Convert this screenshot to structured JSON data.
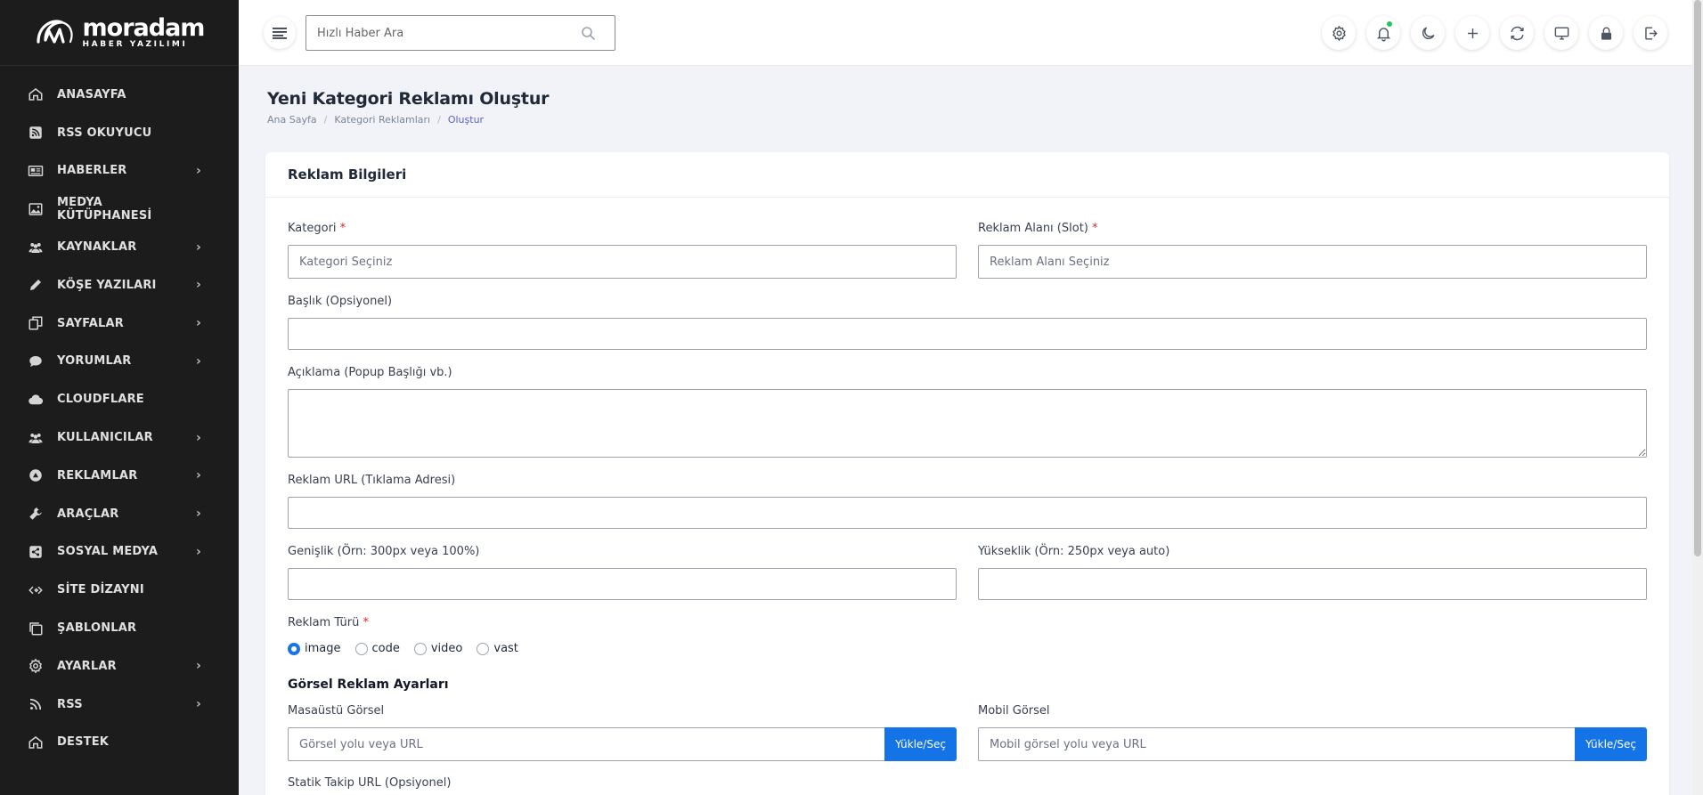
{
  "brand": {
    "name": "moradam",
    "subtitle": "HABER YAZILIMI"
  },
  "sidebar": {
    "items": [
      {
        "label": "ANASAYFA",
        "icon": "home-icon",
        "has_children": false
      },
      {
        "label": "RSS OKUYUCU",
        "icon": "rss-square-icon",
        "has_children": false
      },
      {
        "label": "HABERLER",
        "icon": "newspaper-icon",
        "has_children": true
      },
      {
        "label": "MEDYA KÜTÜPHANESİ",
        "icon": "image-icon",
        "has_children": false
      },
      {
        "label": "KAYNAKLAR",
        "icon": "users-icon",
        "has_children": true
      },
      {
        "label": "KÖŞE YAZILARI",
        "icon": "pencil-icon",
        "has_children": true
      },
      {
        "label": "SAYFALAR",
        "icon": "pages-icon",
        "has_children": true
      },
      {
        "label": "YORUMLAR",
        "icon": "comment-icon",
        "has_children": true
      },
      {
        "label": "CLOUDFLARE",
        "icon": "cloud-icon",
        "has_children": false
      },
      {
        "label": "KULLANICILAR",
        "icon": "users-icon",
        "has_children": true
      },
      {
        "label": "REKLAMLAR",
        "icon": "ad-icon",
        "has_children": true
      },
      {
        "label": "ARAÇLAR",
        "icon": "wrench-icon",
        "has_children": true
      },
      {
        "label": "SOSYAL MEDYA",
        "icon": "share-icon",
        "has_children": true
      },
      {
        "label": "SİTE DİZAYNI",
        "icon": "code-icon",
        "has_children": false
      },
      {
        "label": "ŞABLONLAR",
        "icon": "copy-icon",
        "has_children": false
      },
      {
        "label": "AYARLAR",
        "icon": "gear-icon",
        "has_children": true
      },
      {
        "label": "RSS",
        "icon": "rss-icon",
        "has_children": true
      },
      {
        "label": "DESTEK",
        "icon": "home-icon",
        "has_children": false
      }
    ],
    "chevron": "›"
  },
  "topbar": {
    "search_placeholder": "Hızlı Haber Ara",
    "icons": [
      "gear-icon",
      "bell-icon",
      "moon-icon",
      "plus-icon",
      "refresh-icon",
      "monitor-icon",
      "lock-icon",
      "logout-icon"
    ],
    "notification_dot_color": "#22c55e"
  },
  "page": {
    "title": "Yeni Kategori Reklamı Oluştur",
    "breadcrumb": [
      "Ana Sayfa",
      "Kategori Reklamları",
      "Oluştur"
    ],
    "breadcrumb_sep": "/"
  },
  "form": {
    "card_title": "Reklam Bilgileri",
    "required_mark": "*",
    "kategori": {
      "label": "Kategori",
      "placeholder": "Kategori Seçiniz"
    },
    "slot": {
      "label": "Reklam Alanı (Slot)",
      "placeholder": "Reklam Alanı Seçiniz"
    },
    "baslik": {
      "label": "Başlık (Opsiyonel)",
      "value": ""
    },
    "aciklama": {
      "label": "Açıklama (Popup Başlığı vb.)",
      "value": ""
    },
    "url": {
      "label": "Reklam URL (Tıklama Adresi)",
      "value": ""
    },
    "genislik": {
      "label": "Genişlik (Örn: 300px veya 100%)",
      "value": ""
    },
    "yukseklik": {
      "label": "Yükseklik (Örn: 250px veya auto)",
      "value": ""
    },
    "tur": {
      "label": "Reklam Türü",
      "options": [
        "image",
        "code",
        "video",
        "vast"
      ],
      "selected": "image"
    },
    "gorsel_section": "Görsel Reklam Ayarları",
    "masaustu": {
      "label": "Masaüstü Görsel",
      "placeholder": "Görsel yolu veya URL",
      "button": "Yükle/Seç"
    },
    "mobil": {
      "label": "Mobil Görsel",
      "placeholder": "Mobil görsel yolu veya URL",
      "button": "Yükle/Seç"
    },
    "takip": {
      "label": "Statik Takip URL (Opsiyonel)"
    }
  },
  "colors": {
    "sidebar_bg": "#1c1c1c",
    "accent": "#1473e6",
    "page_bg": "#f1f3f9",
    "required": "#dc2626"
  }
}
